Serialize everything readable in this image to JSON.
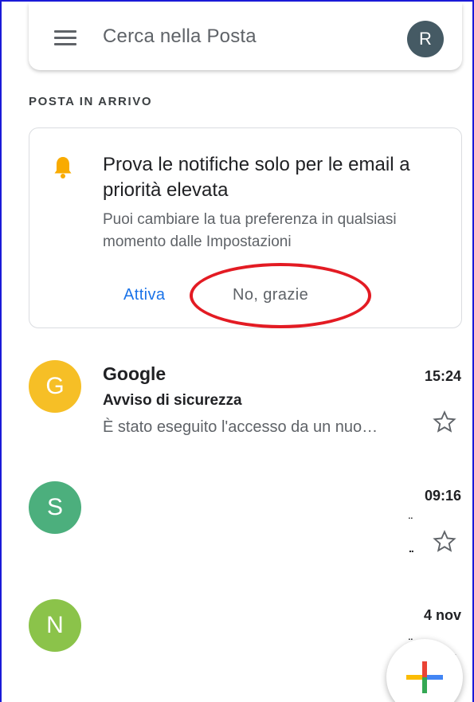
{
  "search": {
    "placeholder": "Cerca nella Posta",
    "account_initial": "R"
  },
  "section": {
    "label": "POSTA IN ARRIVO"
  },
  "notification_card": {
    "title": "Prova le notifiche solo per le email a priorità elevata",
    "subtitle": "Puoi cambiare la tua preferenza in qualsiasi momento dalle Impostazioni",
    "enable_label": "Attiva",
    "dismiss_label": "No, grazie"
  },
  "emails": [
    {
      "initial": "G",
      "sender": "Google",
      "time": "15:24",
      "subject": "Avviso di sicurezza",
      "snippet": "È stato eseguito l'accesso da un nuo…",
      "avatar_color": "#f6bf26"
    },
    {
      "initial": "S",
      "sender": "",
      "time": "09:16",
      "subject": "",
      "snippet": "",
      "avatar_color": "#4caf7d"
    },
    {
      "initial": "N",
      "sender": "",
      "time": "4 nov",
      "subject": "",
      "snippet": "",
      "avatar_color": "#8bc34a"
    }
  ],
  "colors": {
    "accent": "#1a73e8",
    "highlight": "#e31b23",
    "bell": "#f9ab00"
  }
}
